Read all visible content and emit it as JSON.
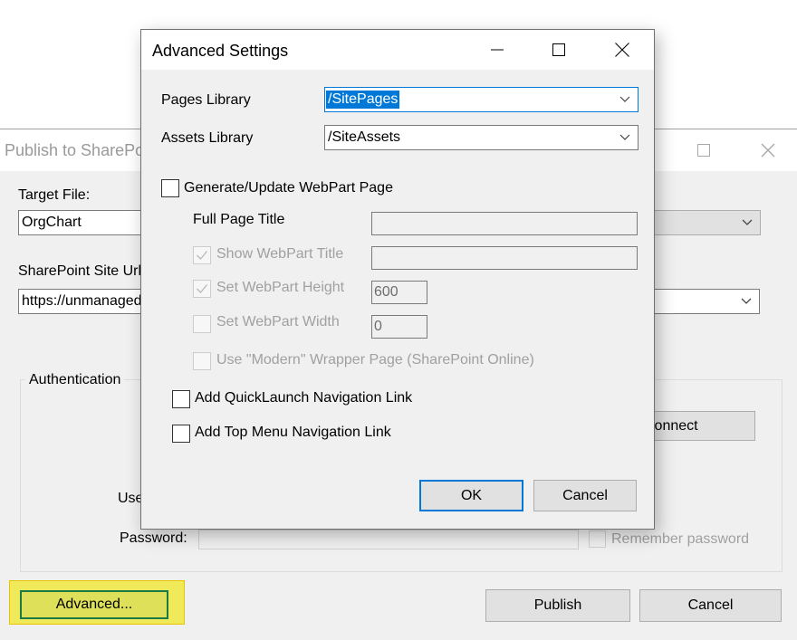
{
  "parent_dialog": {
    "title": "Publish to SharePoint",
    "target_file": {
      "label": "Target File:",
      "value": "OrgChart"
    },
    "site_url": {
      "label": "SharePoint Site Url:",
      "value": "https://unmanaged"
    },
    "authentication": {
      "legend": "Authentication",
      "connect_label": "Connect",
      "user_label": "User:",
      "password_label": "Password:",
      "password_value": "",
      "remember_password_label": "Remember password",
      "remember_password_checked": false
    },
    "advanced_label": "Advanced...",
    "publish_label": "Publish",
    "cancel_label": "Cancel",
    "highlight_color": "#f0ea5a"
  },
  "advanced_settings": {
    "title": "Advanced Settings",
    "pages_library": {
      "label": "Pages Library",
      "value": "/SitePages"
    },
    "assets_library": {
      "label": "Assets Library",
      "value": "/SiteAssets"
    },
    "generate_webpart_page": {
      "label": "Generate/Update WebPart Page",
      "checked": false
    },
    "full_page_title": {
      "label": "Full Page Title",
      "value": ""
    },
    "show_webpart_title": {
      "label": "Show WebPart Title",
      "checked": true,
      "enabled": false,
      "value": ""
    },
    "set_webpart_height": {
      "label": "Set WebPart Height",
      "checked": true,
      "enabled": false,
      "value": "600"
    },
    "set_webpart_width": {
      "label": "Set WebPart Width",
      "checked": false,
      "enabled": false,
      "value": "0"
    },
    "modern_wrapper": {
      "label": "Use \"Modern\" Wrapper Page (SharePoint Online)",
      "checked": false,
      "enabled": false
    },
    "quicklaunch_link": {
      "label": "Add QuickLaunch Navigation Link",
      "checked": false
    },
    "top_menu_link": {
      "label": "Add Top Menu Navigation Link",
      "checked": false
    },
    "ok_label": "OK",
    "cancel_label": "Cancel",
    "accent_color": "#0078d7"
  },
  "icons": {
    "minimize": "minimize-icon",
    "maximize": "maximize-icon",
    "close": "close-icon",
    "dropdown": "chevron-down-icon",
    "check": "checkmark-icon"
  }
}
